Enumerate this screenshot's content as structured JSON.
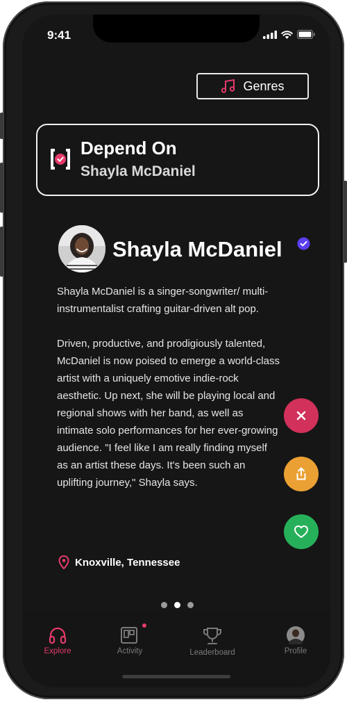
{
  "status_bar": {
    "time": "9:41"
  },
  "genres_button": {
    "label": "Genres",
    "icon": "music-note-icon"
  },
  "now_playing": {
    "title": "Depend On",
    "artist": "Shayla McDaniel"
  },
  "artist": {
    "name": "Shayla McDaniel",
    "verified": true,
    "bio": [
      "Shayla McDaniel is a singer-songwriter/ multi-instrumentalist crafting guitar-driven alt pop.",
      "Driven, productive, and prodigiously talented, McDaniel is now poised to emerge a world-class artist with a uniquely emotive indie-rock aesthetic. Up next, she will be playing local and regional shows with her band, as well as intimate solo performances for her ever-growing audience. \"I feel like I am really finding myself as an artist these days. It's been such an uplifting journey,\" Shayla says."
    ],
    "location": "Knoxville, Tennessee"
  },
  "actions": [
    {
      "name": "dismiss",
      "icon": "close-icon",
      "color": "#d1315a"
    },
    {
      "name": "share",
      "icon": "share-icon",
      "color": "#eba033"
    },
    {
      "name": "like",
      "icon": "heart-icon",
      "color": "#27b05a"
    }
  ],
  "pagination": {
    "count": 3,
    "active": 2
  },
  "tabs": [
    {
      "label": "Explore",
      "icon": "headphones-icon",
      "active": true
    },
    {
      "label": "Activity",
      "icon": "activity-icon",
      "active": false,
      "badge": true
    },
    {
      "label": "Leaderboard",
      "icon": "trophy-icon",
      "active": false
    },
    {
      "label": "Profile",
      "icon": "avatar-icon",
      "active": false
    }
  ],
  "colors": {
    "accent": "#e53a6a",
    "verified": "#5a3ff0",
    "background": "#161616"
  }
}
